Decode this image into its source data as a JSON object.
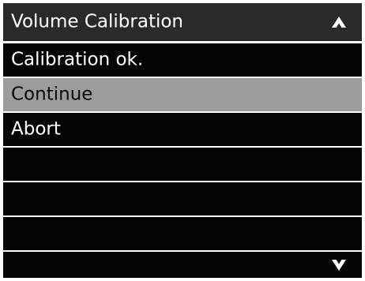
{
  "menu": {
    "title": "Volume Calibration",
    "up_icon": "chevron-up-icon",
    "down_icon": "chevron-down-icon",
    "items": [
      {
        "label": "Calibration ok.",
        "selected": false
      },
      {
        "label": "Continue",
        "selected": true
      },
      {
        "label": "Abort",
        "selected": false
      },
      {
        "label": "",
        "selected": false
      },
      {
        "label": "",
        "selected": false
      },
      {
        "label": "",
        "selected": false
      },
      {
        "label": "",
        "selected": false
      }
    ]
  },
  "colors": {
    "title_bg": "#2a2a2a",
    "item_bg": "#050505",
    "selected_bg": "#9c9c9c",
    "text": "#ffffff",
    "selected_text": "#0a0a0a"
  }
}
